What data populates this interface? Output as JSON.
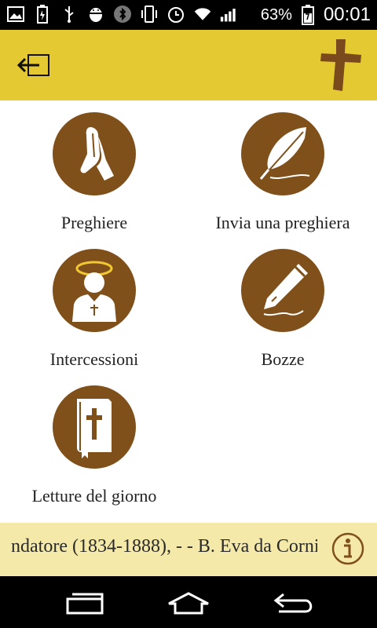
{
  "statusbar": {
    "battery_percent": "63%",
    "time": "00:01",
    "left_icons": [
      "image-icon",
      "battery-saver-icon",
      "usb-icon",
      "android-debug-icon",
      "bluetooth-icon",
      "vibrate-icon",
      "alarm-icon",
      "wifi-icon",
      "signal-icon"
    ],
    "right_icons": [
      "battery-icon"
    ]
  },
  "header": {
    "back_icon": "back-arrow-icon",
    "logo_icon": "cross-icon",
    "accent_color": "#e5c933"
  },
  "menu": {
    "items": [
      {
        "label": "Preghiere",
        "icon": "praying-hands-icon"
      },
      {
        "label": "Invia una preghiera",
        "icon": "quill-feather-icon"
      },
      {
        "label": "Intercessioni",
        "icon": "saint-halo-icon"
      },
      {
        "label": "Bozze",
        "icon": "pen-icon"
      },
      {
        "label": "Letture del giorno",
        "icon": "bible-icon"
      }
    ],
    "circle_color": "#80501b"
  },
  "ticker": {
    "text": "ndatore (1834-1888), -  - B. Eva da Corni",
    "info_icon": "info-icon",
    "background": "#f4e9a8"
  },
  "navbar": {
    "icons": [
      "recent-apps-icon",
      "home-icon",
      "back-icon"
    ]
  }
}
